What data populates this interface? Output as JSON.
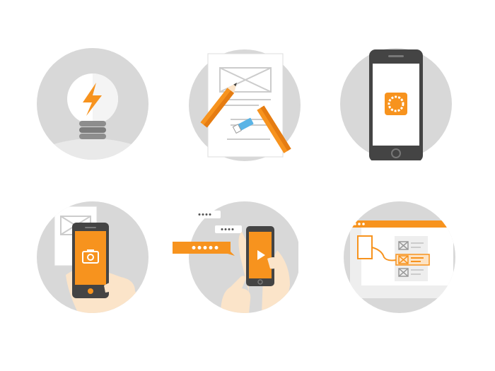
{
  "palette": {
    "circle": "#d8d8d8",
    "accent": "#f7931e",
    "dark": "#444444",
    "paper": "#ffffff",
    "line": "#cccccc",
    "skin": "#fbe4c9"
  },
  "illustrations": [
    {
      "id": "idea",
      "icon": "lightbulb-lightning-icon"
    },
    {
      "id": "wireframe-sketch",
      "icon": "paper-pencils-icon"
    },
    {
      "id": "app-launch",
      "icon": "phone-app-icon"
    },
    {
      "id": "photo-capture",
      "icon": "phone-camera-icon"
    },
    {
      "id": "messaging-video",
      "icon": "phone-video-chat-icon"
    },
    {
      "id": "web-prototype",
      "icon": "browser-wireframe-icon"
    }
  ]
}
